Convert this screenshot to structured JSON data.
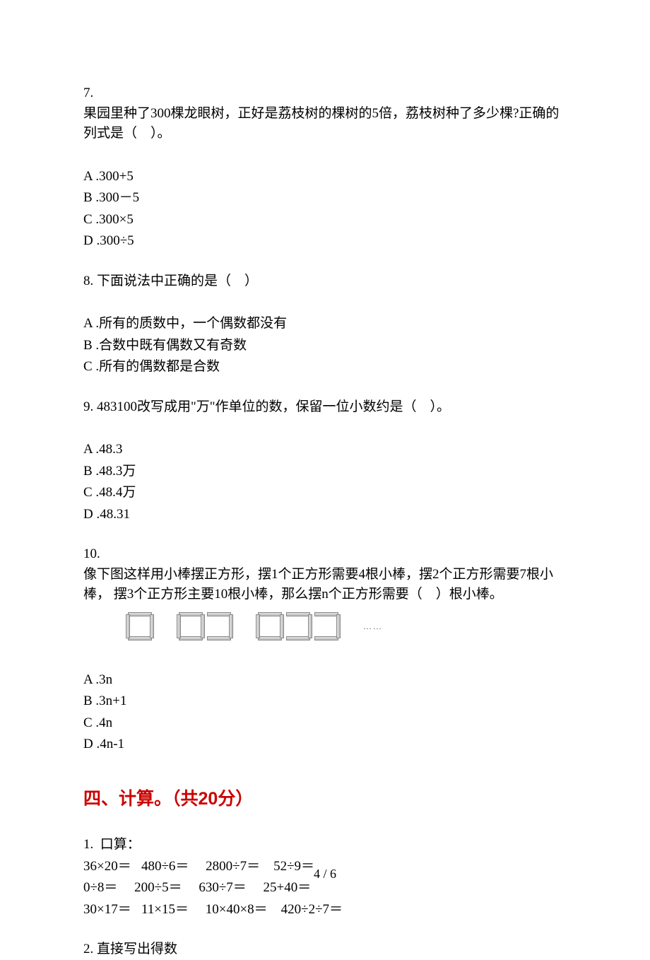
{
  "q7": {
    "num": "7.",
    "text": "果园里种了300棵龙眼树，正好是荔枝树的棵树的5倍，荔枝树种了多少棵?正确的列式是（　）。",
    "options": {
      "A": "A .300+5",
      "B": "B .300－5",
      "C": "C .300×5",
      "D": "D .300÷5"
    }
  },
  "q8": {
    "stem": "8.  下面说法中正确的是（　）",
    "options": {
      "A": "A .所有的质数中，一个偶数都没有",
      "B": "B .合数中既有偶数又有奇数",
      "C": "C .所有的偶数都是合数"
    }
  },
  "q9": {
    "stem": "9.  483100改写成用\"万\"作单位的数，保留一位小数约是（　）。",
    "options": {
      "A": "A .48.3",
      "B": "B .48.3万",
      "C": "C .48.4万",
      "D": "D .48.31"
    }
  },
  "q10": {
    "num": "10.",
    "text": "像下图这样用小棒摆正方形，摆1个正方形需要4根小棒，摆2个正方形需要7根小棒， 摆3个正方形主要10根小棒，那么摆n个正方形需要（　）根小棒。",
    "dots": "……",
    "options": {
      "A": "A .3n",
      "B": "B .3n+1",
      "C": "C .4n",
      "D": "D .4n-1"
    }
  },
  "section4": {
    "title": "四、计算。（共20分）"
  },
  "calc1": {
    "stem": "1.  口算：",
    "line1": "36×20＝   480÷6＝     2800÷7＝    52÷9＝",
    "line2": "0÷8＝     200÷5＝     630÷7＝     25+40＝",
    "line3": "30×17＝   11×15＝     10×40×8＝    420÷2÷7＝"
  },
  "calc2": {
    "stem": "2.  直接写出得数"
  },
  "pageNumber": "4 / 6"
}
